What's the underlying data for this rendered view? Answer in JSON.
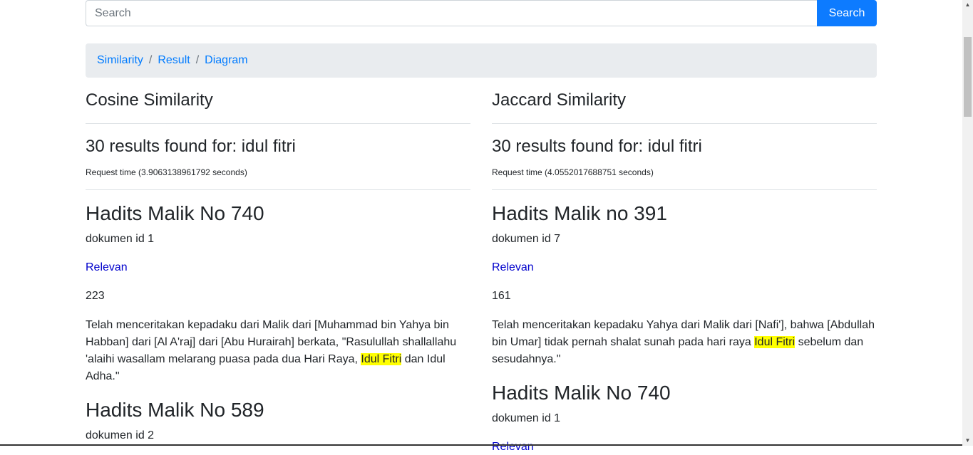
{
  "search": {
    "placeholder": "Search",
    "value": "",
    "button_label": "Search"
  },
  "breadcrumb": [
    "Similarity",
    "Result",
    "Diagram"
  ],
  "columns": [
    {
      "method": "Cosine Similarity",
      "results_title": "30 results found for: idul fitri",
      "request_time": "Request time (3.9063138961792 seconds)",
      "docs": [
        {
          "title": "Hadits Malik No 740",
          "doc_id": "dokumen id 1",
          "relevan": "Relevan",
          "score": "223",
          "text_before": "Telah menceritakan kepadaku dari Malik dari [Muhammad bin Yahya bin Habban] dari [Al A'raj] dari [Abu Hurairah] berkata, \"Rasulullah shallallahu 'alaihi wasallam melarang puasa pada dua Hari Raya, ",
          "highlight": "Idul Fitri",
          "text_after": " dan Idul Adha.\""
        },
        {
          "title": "Hadits Malik No 589",
          "doc_id": "dokumen id 2"
        }
      ]
    },
    {
      "method": "Jaccard Similarity",
      "results_title": "30 results found for: idul fitri",
      "request_time": "Request time (4.0552017688751 seconds)",
      "docs": [
        {
          "title": "Hadits Malik no 391",
          "doc_id": "dokumen id 7",
          "relevan": "Relevan",
          "score": "161",
          "text_before": "Telah menceritakan kepadaku Yahya dari Malik dari [Nafi'], bahwa [Abdullah bin Umar] tidak pernah shalat sunah pada hari raya ",
          "highlight": "Idul Fitri",
          "text_after": " sebelum dan sesudahnya.\""
        },
        {
          "title": "Hadits Malik No 740",
          "doc_id": "dokumen id 1",
          "relevan": "Relevan"
        }
      ]
    }
  ],
  "colors": {
    "primary": "#0d7bff",
    "link": "#007bff",
    "highlight": "#ffff00",
    "breadcrumb_bg": "#e9ecef"
  }
}
